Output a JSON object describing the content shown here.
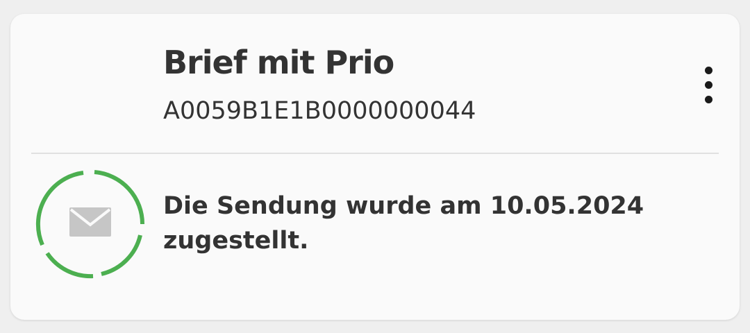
{
  "shipment": {
    "title": "Brief mit Prio",
    "tracking_number": "A0059B1E1B0000000044",
    "status_text": "Die Sendung wurde am 10.05.2024 zugestellt.",
    "status_progress": 1.0
  },
  "icons": {
    "status": "envelope-icon",
    "menu": "more-vertical-icon"
  },
  "colors": {
    "progress": "#4caf50",
    "envelope": "#c6c6c6",
    "text": "#333333"
  }
}
